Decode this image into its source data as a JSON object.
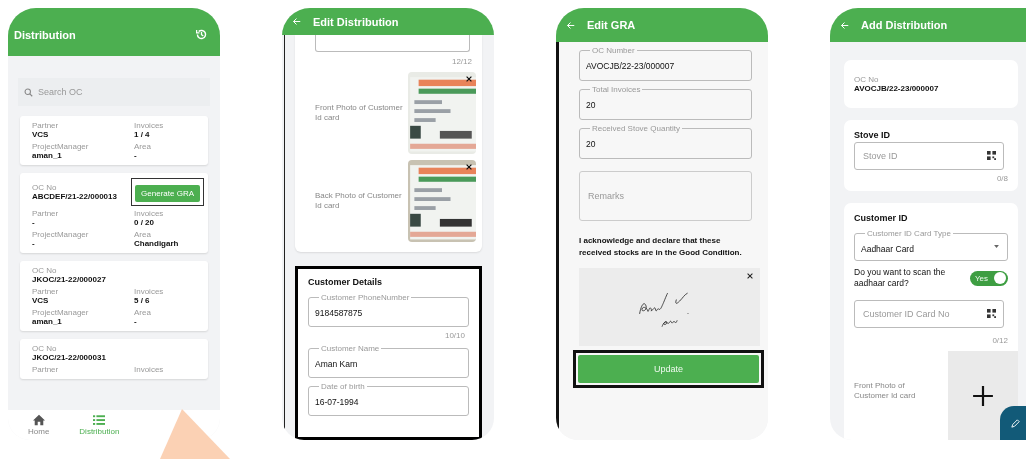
{
  "distribution_list": {
    "title": "Distribution",
    "search": {
      "placeholder": "Search OC"
    },
    "cards": [
      {
        "fields": [
          {
            "label": "Partner",
            "value": "VCS"
          },
          {
            "label": "Invoices",
            "value": "1 / 4"
          },
          {
            "label": "ProjectManager",
            "value": "aman_1"
          },
          {
            "label": "Area",
            "value": "-"
          }
        ]
      },
      {
        "oc_no": {
          "label": "OC No",
          "value": "ABCDEF/21-22/000013"
        },
        "action": {
          "label": "Generate GRA",
          "highlighted": true
        },
        "fields": [
          {
            "label": "Partner",
            "value": "-"
          },
          {
            "label": "Invoices",
            "value": "0 / 20"
          },
          {
            "label": "ProjectManager",
            "value": "-"
          },
          {
            "label": "Area",
            "value": "Chandigarh"
          }
        ]
      },
      {
        "oc_no": {
          "label": "OC No",
          "value": "JKOC/21-22/000027"
        },
        "fields": [
          {
            "label": "Partner",
            "value": "VCS"
          },
          {
            "label": "Invoices",
            "value": "5 / 6"
          },
          {
            "label": "ProjectManager",
            "value": "aman_1"
          },
          {
            "label": "Area",
            "value": "-"
          }
        ]
      },
      {
        "oc_no": {
          "label": "OC No",
          "value": "JKOC/21-22/000031"
        },
        "fields": [
          {
            "label": "Partner"
          },
          {
            "label": "Invoices"
          }
        ]
      }
    ],
    "nav": [
      {
        "label": "Home",
        "selected": false
      },
      {
        "label": "Distribution",
        "selected": true
      }
    ]
  },
  "edit_distribution": {
    "title": "Edit Distribution",
    "top_counter": "12/12",
    "photos": [
      {
        "label": "Front Photo of Customer Id card"
      },
      {
        "label": "Back Photo of Customer Id card"
      }
    ],
    "customer_details": {
      "title": "Customer Details",
      "highlighted": true,
      "fields": [
        {
          "label": "Customer PhoneNumber",
          "value": "9184587875",
          "counter": "10/10"
        },
        {
          "label": "Customer Name",
          "value": "Aman Karn"
        },
        {
          "label": "Date of birth",
          "value": "16-07-1994"
        }
      ]
    }
  },
  "edit_gra": {
    "title": "Edit GRA",
    "fields": [
      {
        "label": "OC Number",
        "value": "AVOCJB/22-23/000007"
      },
      {
        "label": "Total Invoices",
        "value": "20"
      },
      {
        "label": "Received Stove Quantity",
        "value": "20"
      }
    ],
    "remarks": {
      "placeholder": "Remarks"
    },
    "declaration": "I acknowledge and declare that these received stocks are in the Good Condition.",
    "update_button": {
      "label": "Update",
      "highlighted": true
    }
  },
  "add_distribution": {
    "title": "Add Distribution",
    "oc": {
      "label": "OC No",
      "value": "AVOCJB/22-23/000007"
    },
    "stove": {
      "title": "Stove ID",
      "placeholder": "Stove ID",
      "counter": "0/8"
    },
    "customer_id": {
      "title": "Customer ID",
      "card_type": {
        "label": "Customer ID Card Type",
        "value": "Aadhaar Card"
      },
      "scan": {
        "question": "Do you want to scan the aadhaar card?",
        "label": "Yes",
        "on": true
      },
      "id_no": {
        "placeholder": "Customer ID Card No",
        "counter": "0/12"
      },
      "photo_label": "Front Photo of Customer Id card"
    }
  }
}
